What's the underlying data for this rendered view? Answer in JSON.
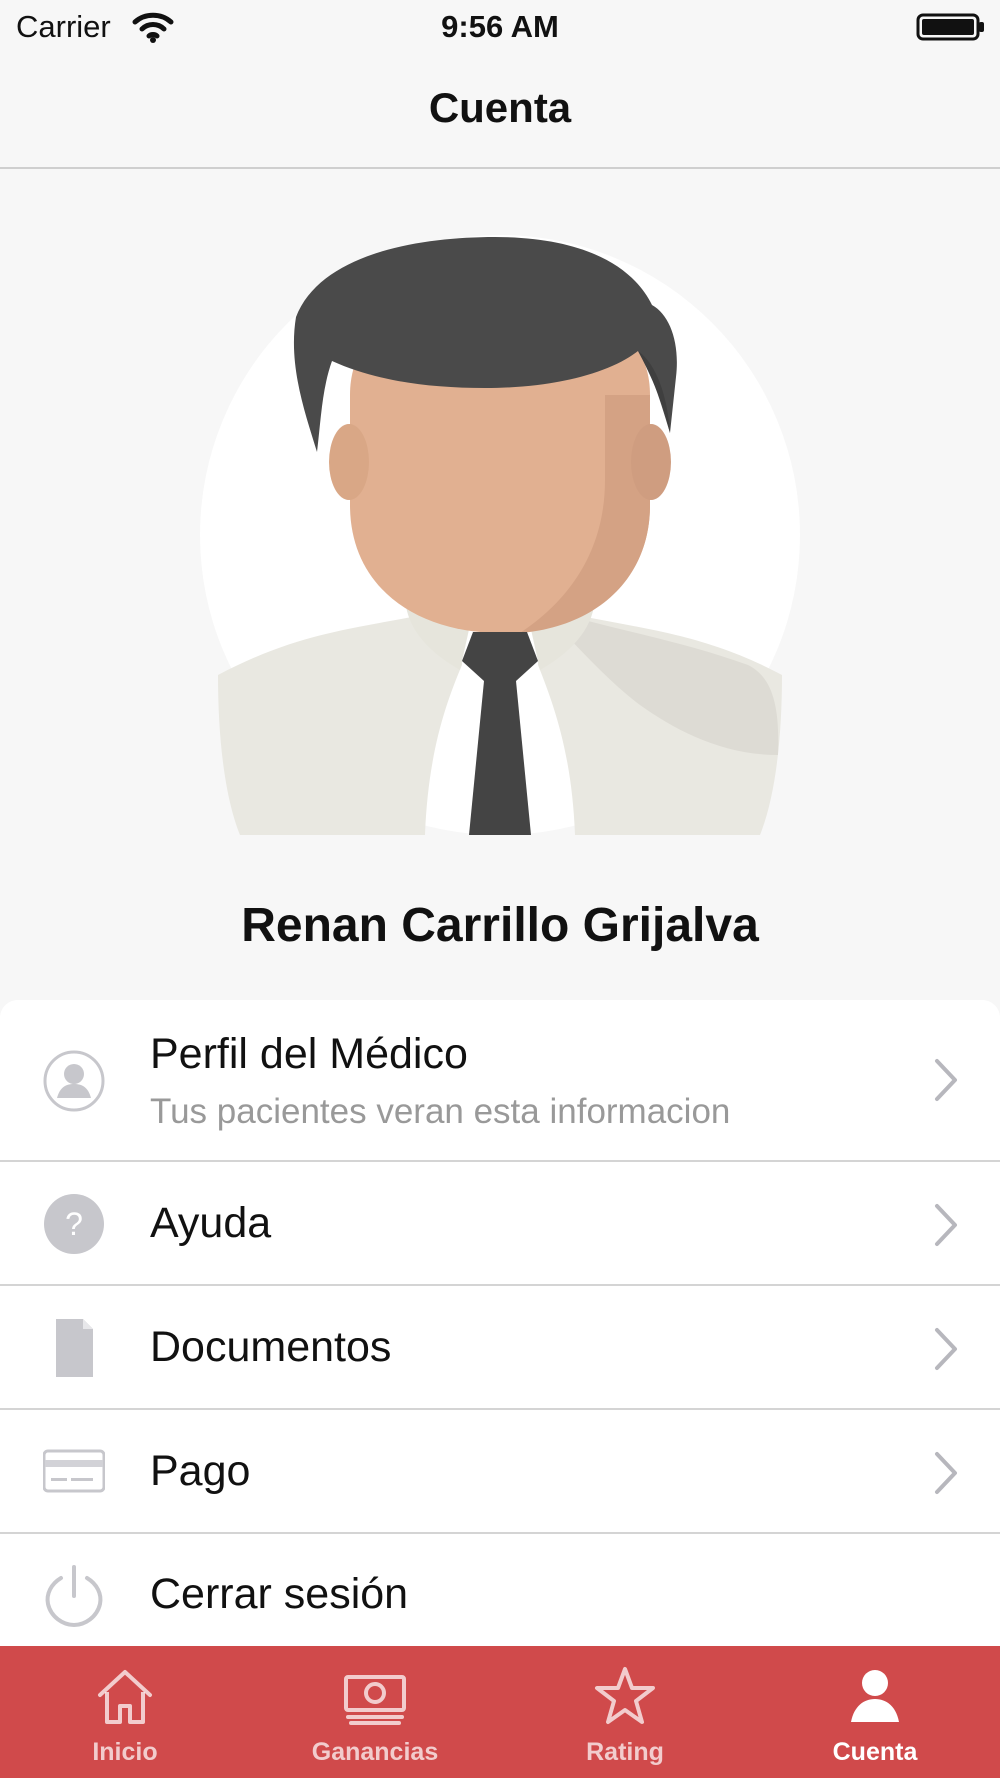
{
  "status_bar": {
    "carrier": "Carrier",
    "time": "9:56 AM"
  },
  "nav": {
    "title": "Cuenta"
  },
  "profile": {
    "name": "Renan Carrillo Grijalva"
  },
  "menu": {
    "items": [
      {
        "icon": "user-outline-icon",
        "title": "Perfil del Médico",
        "subtitle": "Tus pacientes veran esta informacion"
      },
      {
        "icon": "help-circle-icon",
        "title": "Ayuda"
      },
      {
        "icon": "document-icon",
        "title": "Documentos"
      },
      {
        "icon": "credit-card-icon",
        "title": "Pago"
      },
      {
        "icon": "power-icon",
        "title": "Cerrar sesión"
      }
    ]
  },
  "tabs": [
    {
      "icon": "home-icon",
      "label": "Inicio",
      "active": false
    },
    {
      "icon": "money-icon",
      "label": "Ganancias",
      "active": false
    },
    {
      "icon": "star-icon",
      "label": "Rating",
      "active": false
    },
    {
      "icon": "person-icon",
      "label": "Cuenta",
      "active": true
    }
  ],
  "colors": {
    "tab_bar": "#d04a4b",
    "background": "#f7f7f7",
    "text": "#111111",
    "muted_text": "#999999",
    "icon_gray": "#c7c7cc"
  }
}
